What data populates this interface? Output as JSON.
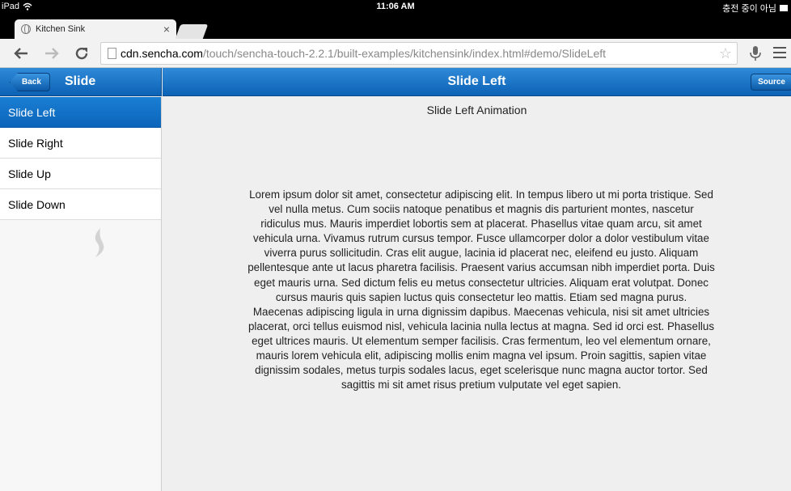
{
  "status_bar": {
    "device": "iPad",
    "time": "11:06 AM",
    "battery_text": "충전 중이 아님"
  },
  "browser": {
    "tab_title": "Kitchen Sink",
    "tab_close": "×",
    "url_domain": "cdn.sencha.com",
    "url_path": "/touch/sencha-touch-2.2.1/built-examples/kitchensink/index.html#demo/SlideLeft",
    "icons": [
      "back-arrow-icon",
      "forward-arrow-icon",
      "reload-icon",
      "page-icon",
      "star-icon",
      "microphone-icon",
      "menu-icon"
    ]
  },
  "app": {
    "back_label": "Back",
    "nav_title": "Slide",
    "page_title": "Slide Left",
    "source_label": "Source",
    "nav_items": [
      "Slide Left",
      "Slide Right",
      "Slide Up",
      "Slide Down"
    ],
    "selected_index": 0,
    "content_heading": "Slide Left Animation",
    "paragraphs": [
      "Lorem ipsum dolor sit amet, consectetur adipiscing elit. In tempus libero ut mi porta tristique. Sed vel nulla metus. Cum sociis natoque penatibus et magnis dis parturient montes, nascetur ridiculus mus. Mauris imperdiet lobortis sem at placerat. Phasellus vitae quam arcu, sit amet vehicula urna. Vivamus rutrum cursus tempor. Fusce ullamcorper dolor a dolor vestibulum vitae viverra purus sollicitudin. Cras elit augue, lacinia id placerat nec, eleifend eu justo. Aliquam pellentesque ante ut lacus pharetra facilisis. Praesent varius accumsan nibh imperdiet porta. Duis eget mauris urna. Sed dictum felis eu metus consectetur ultricies. Aliquam erat volutpat. Donec cursus mauris quis sapien luctus quis consectetur leo mattis. Etiam sed magna purus.",
      "Maecenas adipiscing ligula in urna dignissim dapibus. Maecenas vehicula, nisi sit amet ultricies placerat, orci tellus euismod nisl, vehicula lacinia nulla lectus at magna. Sed id orci est. Phasellus eget ultrices mauris. Ut elementum semper facilisis. Cras fermentum, leo vel elementum ornare, mauris lorem vehicula elit, adipiscing mollis enim magna vel ipsum. Proin sagittis, sapien vitae dignissim sodales, metus turpis sodales lacus, eget scelerisque nunc magna auctor tortor. Sed sagittis mi sit amet risus pretium vulputate vel eget sapien."
    ]
  },
  "colors": {
    "toolbar_blue": "#1670c6",
    "selected_blue": "#0f6cc0",
    "content_bg": "#efefef"
  }
}
